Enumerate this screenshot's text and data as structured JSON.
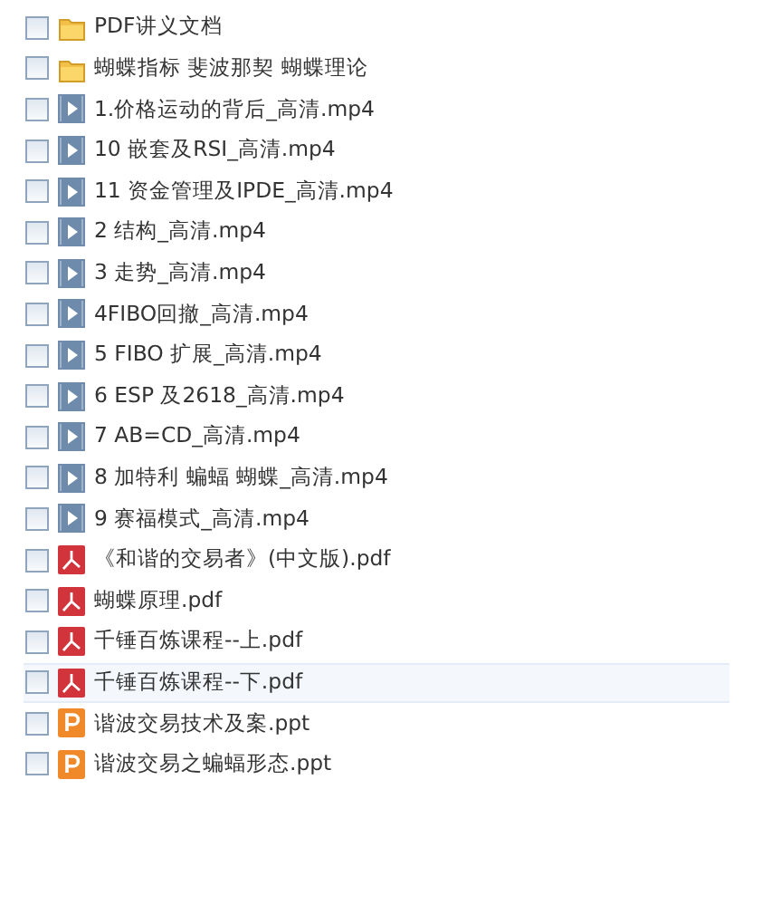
{
  "files": [
    {
      "kind": "folder",
      "name": "PDF讲义文档",
      "checked": false,
      "hovered": false
    },
    {
      "kind": "folder",
      "name": "蝴蝶指标 斐波那契 蝴蝶理论",
      "checked": false,
      "hovered": false
    },
    {
      "kind": "video",
      "name": "1.价格运动的背后_高清.mp4",
      "checked": false,
      "hovered": false
    },
    {
      "kind": "video",
      "name": "10 嵌套及RSI_高清.mp4",
      "checked": false,
      "hovered": false
    },
    {
      "kind": "video",
      "name": "11 资金管理及IPDE_高清.mp4",
      "checked": false,
      "hovered": false
    },
    {
      "kind": "video",
      "name": "2 结构_高清.mp4",
      "checked": false,
      "hovered": false
    },
    {
      "kind": "video",
      "name": "3 走势_高清.mp4",
      "checked": false,
      "hovered": false
    },
    {
      "kind": "video",
      "name": "4FIBO回撤_高清.mp4",
      "checked": false,
      "hovered": false
    },
    {
      "kind": "video",
      "name": "5 FIBO 扩展_高清.mp4",
      "checked": false,
      "hovered": false
    },
    {
      "kind": "video",
      "name": "6 ESP 及2618_高清.mp4",
      "checked": false,
      "hovered": false
    },
    {
      "kind": "video",
      "name": "7 AB=CD_高清.mp4",
      "checked": false,
      "hovered": false
    },
    {
      "kind": "video",
      "name": "8 加特利 蝙蝠 蝴蝶_高清.mp4",
      "checked": false,
      "hovered": false
    },
    {
      "kind": "video",
      "name": "9 赛福模式_高清.mp4",
      "checked": false,
      "hovered": false
    },
    {
      "kind": "pdf",
      "name": "《和谐的交易者》(中文版).pdf",
      "checked": false,
      "hovered": false
    },
    {
      "kind": "pdf",
      "name": "蝴蝶原理.pdf",
      "checked": false,
      "hovered": false
    },
    {
      "kind": "pdf",
      "name": "千锤百炼课程--上.pdf",
      "checked": false,
      "hovered": false
    },
    {
      "kind": "pdf",
      "name": "千锤百炼课程--下.pdf",
      "checked": false,
      "hovered": true
    },
    {
      "kind": "ppt",
      "name": "谐波交易技术及案.ppt",
      "checked": false,
      "hovered": false
    },
    {
      "kind": "ppt",
      "name": "谐波交易之蝙蝠形态.ppt",
      "checked": false,
      "hovered": false
    }
  ]
}
